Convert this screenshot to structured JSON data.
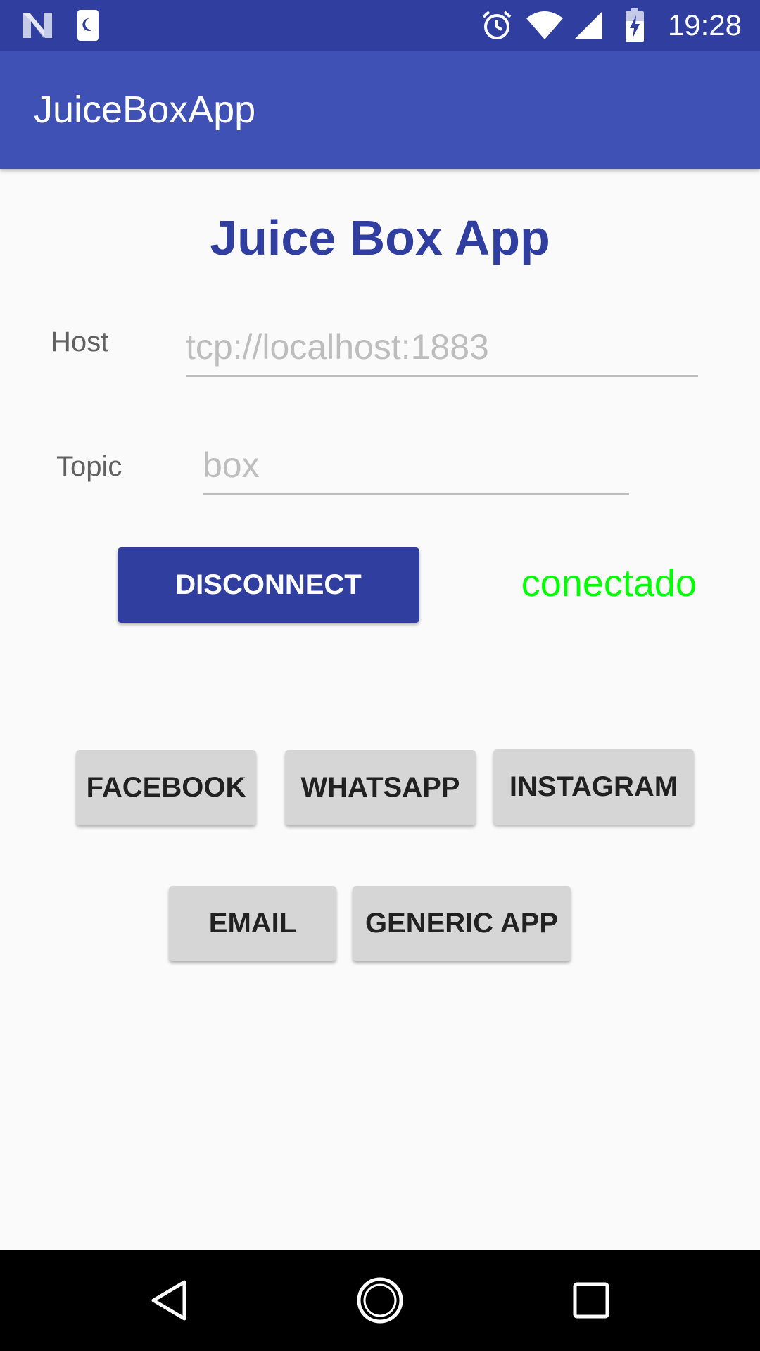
{
  "status_bar": {
    "time": "19:28",
    "icons": [
      "notification-n-icon",
      "sim-moon-icon",
      "alarm-icon",
      "wifi-icon",
      "cell-signal-icon",
      "battery-charging-icon"
    ]
  },
  "app_bar": {
    "title": "JuiceBoxApp"
  },
  "main": {
    "title": "Juice Box App",
    "host": {
      "label": "Host",
      "value": "",
      "placeholder": "tcp://localhost:1883"
    },
    "topic": {
      "label": "Topic",
      "value": "",
      "placeholder": "box"
    },
    "disconnect_label": "DISCONNECT",
    "connection_status": "conectado",
    "app_buttons_row1": [
      "FACEBOOK",
      "WHATSAPP",
      "INSTAGRAM"
    ],
    "app_buttons_row2": [
      "EMAIL",
      "GENERIC APP"
    ]
  },
  "nav_bar": {
    "icons": [
      "back-icon",
      "home-icon",
      "recents-icon"
    ]
  },
  "colors": {
    "status_bar": "#303f9f",
    "app_bar": "#3f51b5",
    "accent": "#303f9f",
    "status_connected": "#00ff00"
  }
}
